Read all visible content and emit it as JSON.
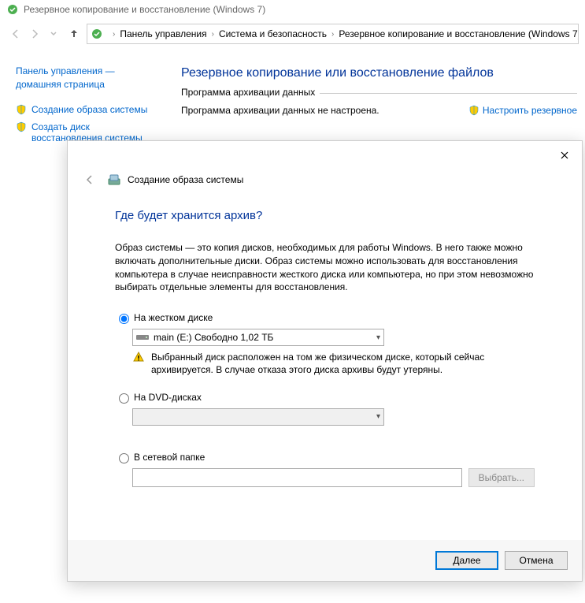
{
  "window": {
    "title": "Резервное копирование и восстановление (Windows 7)"
  },
  "breadcrumb": {
    "items": [
      "Панель управления",
      "Система и безопасность",
      "Резервное копирование и восстановление (Windows 7)"
    ]
  },
  "sidebar": {
    "home_line1": "Панель управления —",
    "home_line2": "домашняя страница",
    "links": [
      "Создание образа системы",
      "Создать диск восстановления системы"
    ]
  },
  "content": {
    "heading": "Резервное копирование или восстановление файлов",
    "group_legend": "Программа архивации данных",
    "status_text": "Программа архивации данных не настроена.",
    "configure_link": "Настроить резервное"
  },
  "dialog": {
    "header_small": "Создание образа системы",
    "heading": "Где будет хранится архив?",
    "description": "Образ системы — это копия дисков, необходимых для работы Windows. В него также можно включать дополнительные диски. Образ системы можно использовать для восстановления компьютера в случае неисправности жесткого диска или компьютера, но при этом невозможно выбирать отдельные элементы для восстановления.",
    "opt_hdd_label": "На жестком диске",
    "opt_hdd_value": "main (E:)  Свободно 1,02 ТБ",
    "opt_hdd_warning": "Выбранный диск расположен на том же физическом диске, который сейчас архивируется. В случае отказа этого диска архивы будут утеряны.",
    "opt_dvd_label": "На DVD-дисках",
    "opt_net_label": "В сетевой папке",
    "opt_net_browse": "Выбрать...",
    "btn_next": "Далее",
    "btn_cancel": "Отмена"
  }
}
